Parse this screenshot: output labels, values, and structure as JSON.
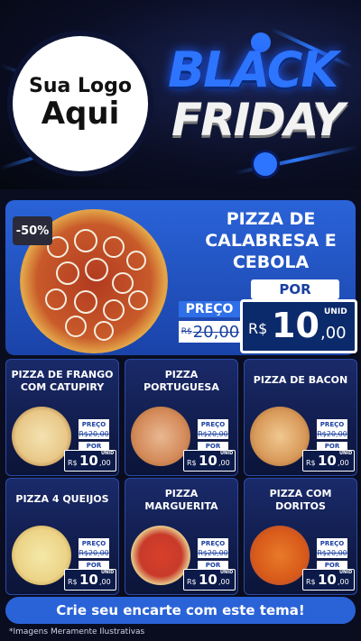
{
  "header": {
    "logo_line1": "Sua Logo",
    "logo_line2": "Aqui",
    "bf_black": "BLACK",
    "bf_friday": "FRIDAY"
  },
  "featured": {
    "discount": "-50%",
    "title": "PIZZA DE CALABRESA E CEBOLA",
    "preco_label": "PREÇO",
    "por_label": "POR",
    "old_currency": "R$",
    "old_price": "20,00",
    "currency": "R$",
    "price_int": "10",
    "price_dec": ",00",
    "unit": "UNID"
  },
  "cards": [
    {
      "title": "PIZZA DE FRANGO COM CATUPIRY",
      "preco_label": "PREÇO",
      "old_price": "R$20,00",
      "por_label": "POR",
      "currency": "R$",
      "price_int": "10",
      "price_dec": ",00",
      "unit": "UNID"
    },
    {
      "title": "PIZZA PORTUGUESA",
      "preco_label": "PREÇO",
      "old_price": "R$20,00",
      "por_label": "POR",
      "currency": "R$",
      "price_int": "10",
      "price_dec": ",00",
      "unit": "UNID"
    },
    {
      "title": "PIZZA DE BACON",
      "preco_label": "PREÇO",
      "old_price": "R$20,00",
      "por_label": "POR",
      "currency": "R$",
      "price_int": "10",
      "price_dec": ",00",
      "unit": "UNID"
    },
    {
      "title": "PIZZA 4 QUEIJOS",
      "preco_label": "PREÇO",
      "old_price": "R$20,00",
      "por_label": "POR",
      "currency": "R$",
      "price_int": "10",
      "price_dec": ",00",
      "unit": "UNID"
    },
    {
      "title": "PIZZA MARGUERITA",
      "preco_label": "PREÇO",
      "old_price": "R$20,00",
      "por_label": "POR",
      "currency": "R$",
      "price_int": "10",
      "price_dec": ",00",
      "unit": "UNID"
    },
    {
      "title": "PIZZA COM DORITOS",
      "preco_label": "PREÇO",
      "old_price": "R$20,00",
      "por_label": "POR",
      "currency": "R$",
      "price_int": "10",
      "price_dec": ",00",
      "unit": "UNID"
    }
  ],
  "cta": "Crie seu encarte com este tema!",
  "disclaimer": "*Imagens Meramente Ilustrativas"
}
